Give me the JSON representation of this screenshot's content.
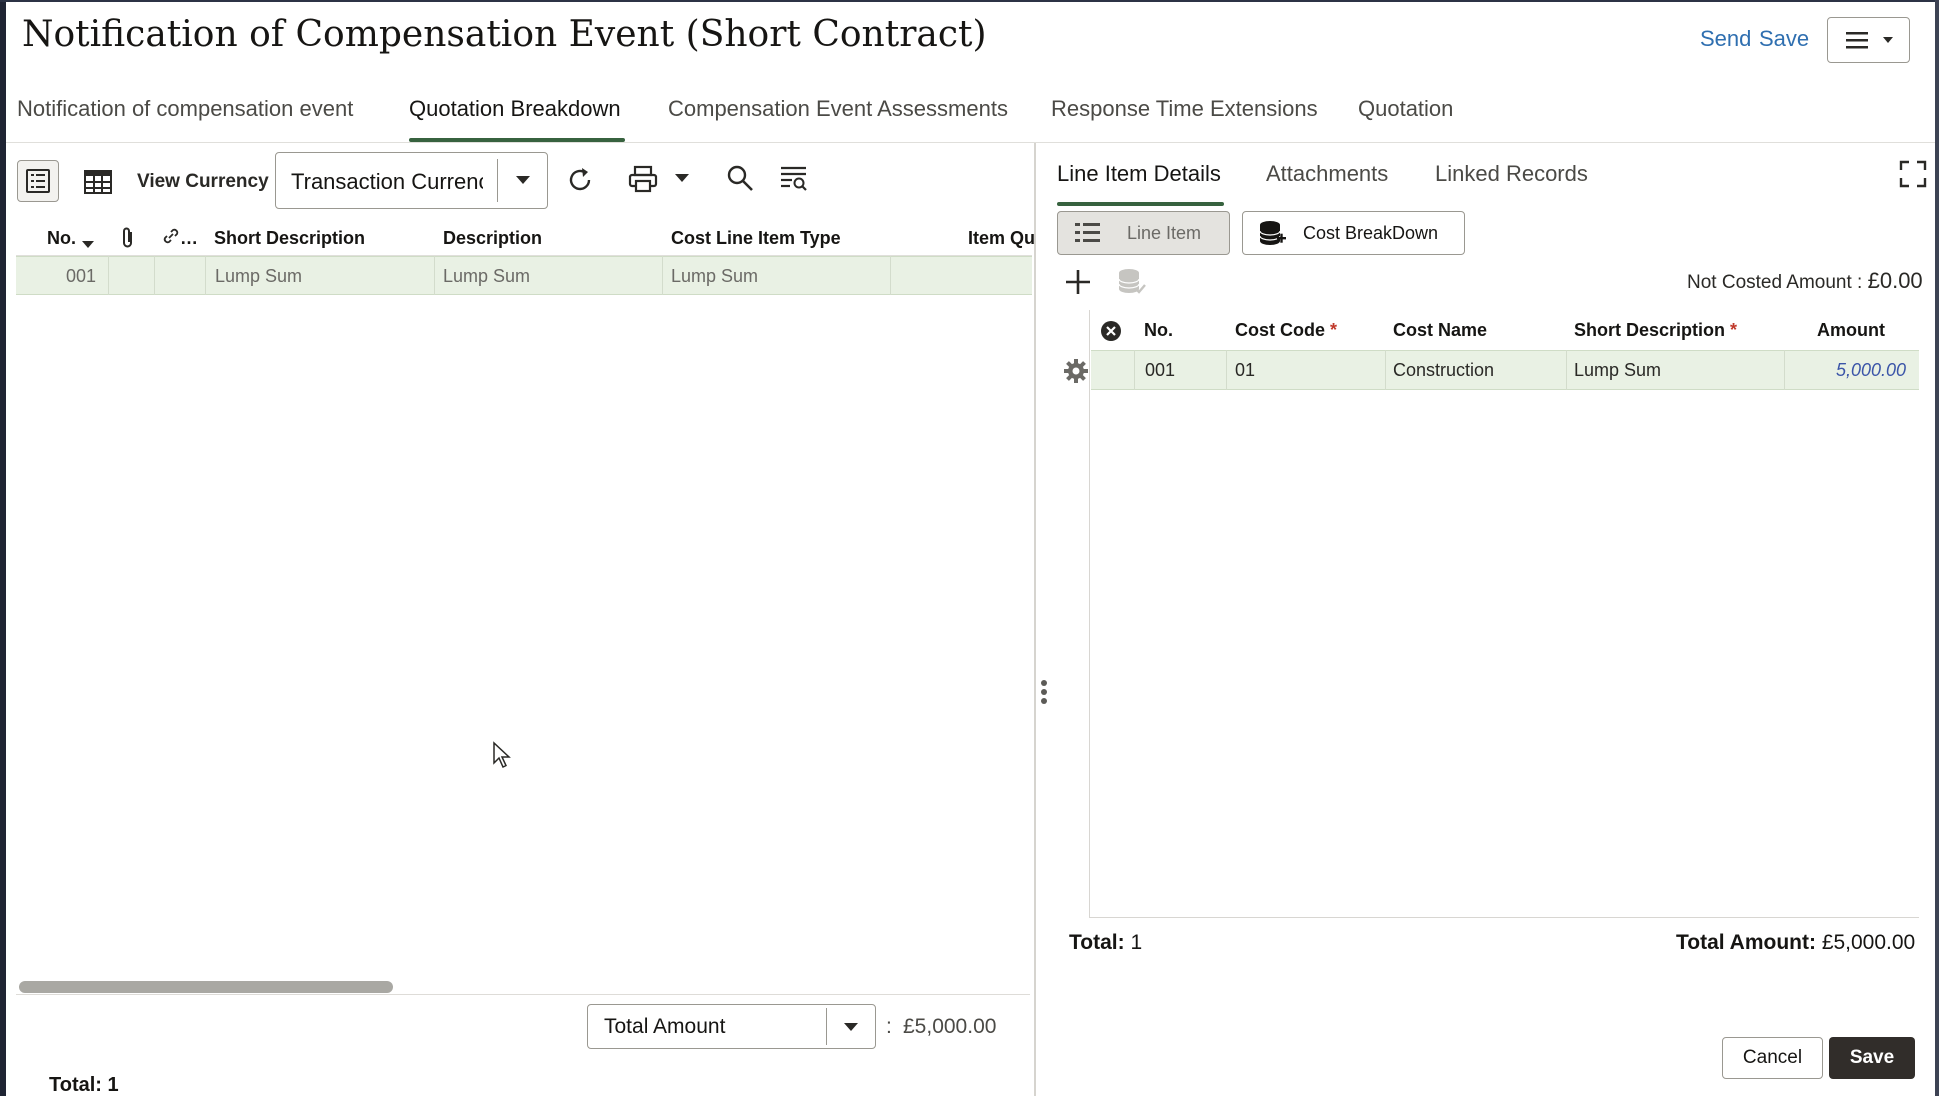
{
  "header": {
    "title": "Notification of Compensation Event (Short Contract)",
    "send_label": "Send",
    "save_label": "Save"
  },
  "tabs": [
    {
      "label": "Notification of compensation event"
    },
    {
      "label": "Quotation Breakdown",
      "active": true
    },
    {
      "label": "Compensation Event Assessments"
    },
    {
      "label": "Response Time Extensions"
    },
    {
      "label": "Quotation"
    }
  ],
  "left_toolbar": {
    "view_currency_label": "View Currency",
    "currency_value": "Transaction Currency"
  },
  "left_grid": {
    "columns": [
      "No.",
      "…",
      "Short Description",
      "Description",
      "Cost Line Item Type",
      "Item Qu"
    ],
    "rows": [
      {
        "no": "001",
        "short_description": "Lump Sum",
        "description": "Lump Sum",
        "cost_line_item_type": "Lump Sum"
      }
    ]
  },
  "left_footer": {
    "aggregate_label": "Total Amount",
    "colon": ":",
    "aggregate_value": "£5,000.00",
    "total": "Total: 1"
  },
  "right_panel": {
    "tabs": [
      {
        "label": "Line Item Details",
        "active": true
      },
      {
        "label": "Attachments"
      },
      {
        "label": "Linked Records"
      }
    ],
    "segments": {
      "line_item": "Line Item",
      "cost_breakdown": "Cost BreakDown"
    },
    "not_costed_label": "Not Costed Amount :",
    "not_costed_value": "£0.00",
    "columns": {
      "no": "No.",
      "cost_code": "Cost Code",
      "cost_name": "Cost Name",
      "short_description": "Short Description",
      "amount": "Amount",
      "required_marker": "*"
    },
    "rows": [
      {
        "no": "001",
        "cost_code": "01",
        "cost_name": "Construction",
        "short_description": "Lump Sum",
        "amount": "5,000.00"
      }
    ],
    "total_label": "Total:",
    "total_value": "1",
    "total_amount_label": "Total Amount:",
    "total_amount_value": "£5,000.00"
  },
  "actions": {
    "cancel_label": "Cancel",
    "save_label": "Save"
  },
  "colors": {
    "accent_green": "#37623f",
    "link_blue": "#2f6fb0",
    "selected_row": "#e9f1e4",
    "primary_button": "#312d2a"
  }
}
